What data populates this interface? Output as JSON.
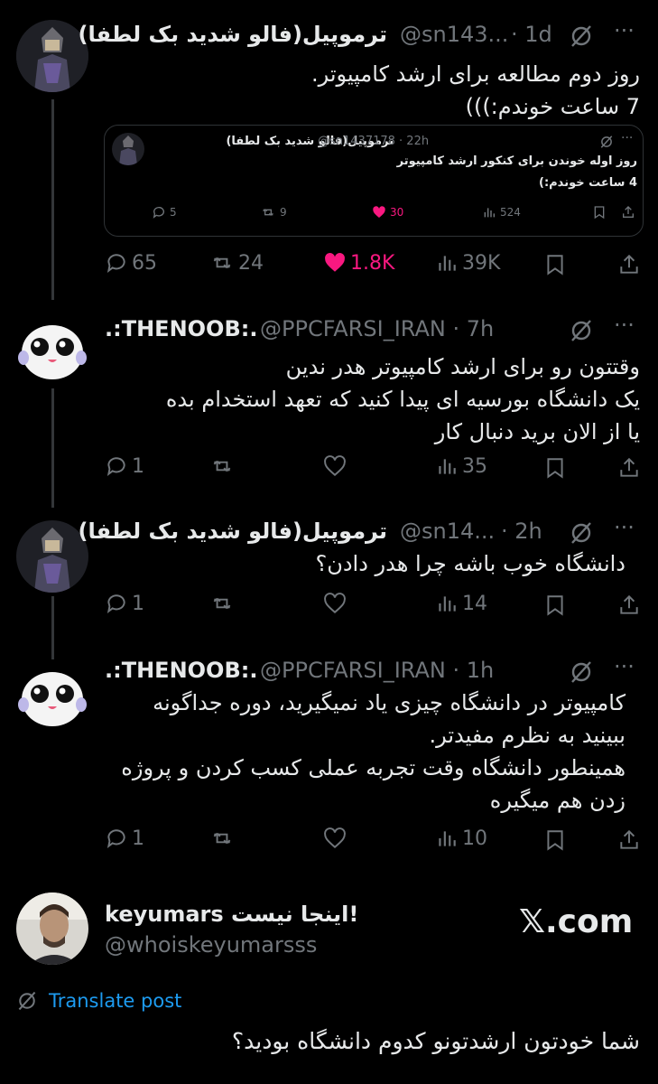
{
  "posts": [
    {
      "name": "ترموپیل(فالو شدید بک لطفا)",
      "handle": "@sn143...",
      "time": "· 1d",
      "text": "روز دوم مطالعه برای ارشد کامپیوتر.\n7 ساعت خوندم:)))",
      "stats": {
        "replies": "65",
        "reposts": "24",
        "likes": "1.8K",
        "views": "39K"
      },
      "liked": true,
      "quote": {
        "name": "ترموپیل(فالو شدید بک لطفا)",
        "handle": "@sn1437178 · 22h",
        "text": "روز اوله خوندن برای کنکور ارشد کامپیوتر\n4 ساعت خوندم:)",
        "stats": {
          "replies": "5",
          "reposts": "9",
          "likes": "30",
          "views": "524"
        }
      }
    },
    {
      "name": ".:THENOOB:.",
      "handle": "@PPCFARSI_IRAN · 7h",
      "text": "وقتتون رو برای ارشد کامپیوتر هدر ندین\nیک دانشگاه بورسیه ای پیدا کنید که تعهد استخدام بده\nیا از الان برید دنبال کار",
      "stats": {
        "replies": "1",
        "reposts": "",
        "likes": "",
        "views": "35"
      }
    },
    {
      "name": "ترموپیل(فالو شدید بک لطفا)",
      "handle": "@sn14...",
      "time": "· 2h",
      "text": "دانشگاه خوب باشه چرا هدر دادن؟",
      "stats": {
        "replies": "1",
        "reposts": "",
        "likes": "",
        "views": "14"
      }
    },
    {
      "name": ".:THENOOB:.",
      "handle": "@PPCFARSI_IRAN · 1h",
      "text": "کامپیوتر در دانشگاه چیزی یاد نمیگیرید، دوره جداگونه\nببینید به نظرم مفیدتر.\nهمینطور دانشگاه وقت تجربه عملی کسب کردن و پروژه\nزدن هم میگیره",
      "stats": {
        "replies": "1",
        "reposts": "",
        "likes": "",
        "views": "10"
      }
    }
  ],
  "final_post": {
    "name": "keyumars اینجا نیست!",
    "handle": "@whoiskeyumarsss",
    "brand": "𝕏.com",
    "translate": "Translate post",
    "text": "شما خودتون ارشدتونو کدوم دانشگاه بودید؟"
  },
  "colors": {
    "bg": "#000000",
    "text": "#e7e9ea",
    "muted": "#71767b",
    "like": "#f91880",
    "link": "#1d9bf0"
  },
  "more": "···"
}
